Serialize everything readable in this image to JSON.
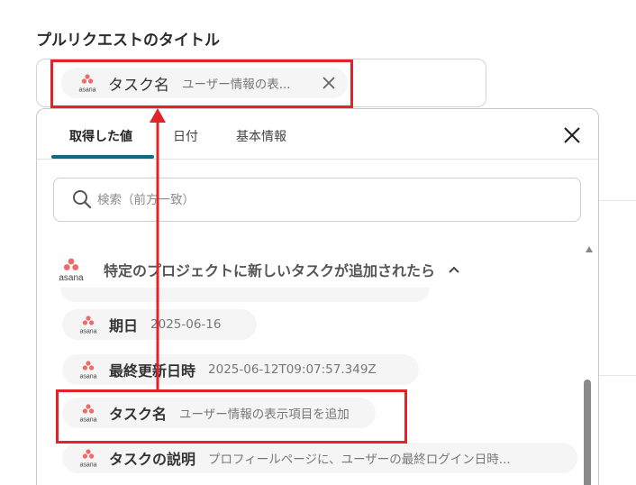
{
  "field": {
    "label": "プルリクエストのタイトル",
    "chip": {
      "title": "タスク名",
      "value": "ユーザー情報の表..."
    }
  },
  "dropdown": {
    "tabs": [
      {
        "label": "取得した値",
        "active": true
      },
      {
        "label": "日付",
        "active": false
      },
      {
        "label": "基本情報",
        "active": false
      }
    ],
    "search": {
      "placeholder": "検索（前方一致）"
    },
    "group": {
      "title": "特定のプロジェクトに新しいタスクが追加されたら",
      "logo_text": "asana",
      "expanded": true
    },
    "items": [
      {
        "title": "期日",
        "value": "2025-06-16"
      },
      {
        "title": "最終更新日時",
        "value": "2025-06-12T09:07:57.349Z"
      },
      {
        "title": "タスク名",
        "value": "ユーザー情報の表示項目を追加"
      },
      {
        "title": "タスクの説明",
        "value": "プロフィールページに、ユーザーの最終ログイン日時..."
      }
    ]
  },
  "logo": {
    "text": "asana"
  },
  "colors": {
    "accent_tab": "#0e6a80",
    "highlight": "#e0242a",
    "asana_coral": "#f06a6a"
  }
}
